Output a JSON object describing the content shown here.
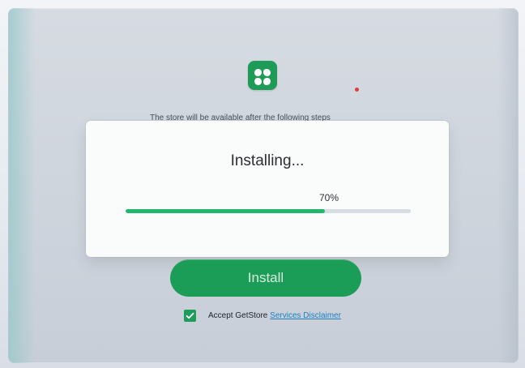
{
  "background_text": "The store will be available after the following steps",
  "dialog": {
    "title": "Installing...",
    "progress_label": "70%",
    "progress_value": 0.7
  },
  "install_button_label": "Install",
  "accept": {
    "prefix": "Accept GetStore ",
    "link_text": "Services Disclaimer",
    "checked": true
  },
  "colors": {
    "accent": "#22b86b",
    "button": "#1c9d57",
    "link": "#1d7fbe",
    "alert_dot": "#e03a3a"
  },
  "icons": {
    "app_logo": "four-petal-logo-icon",
    "checkbox": "checkmark-icon"
  }
}
